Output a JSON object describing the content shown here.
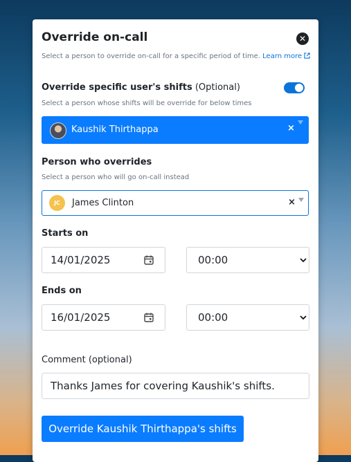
{
  "dialog": {
    "title": "Override on-call",
    "description": "Select a person to override on-call for a specific period of time.",
    "learn_more": "Learn more"
  },
  "override_user": {
    "label_bold": "Override specific user's shifts",
    "label_optional": "(Optional)",
    "toggle_on": true,
    "hint": "Select a person whose shifts will be override for below times",
    "selected_name": "Kaushik Thirthappa",
    "clear": "×"
  },
  "overrider": {
    "label": "Person who overrides",
    "hint": "Select a person who will go on-call instead",
    "initials": "JC",
    "selected_name": "James Clinton",
    "clear": "×",
    "avatar_color": "#f5c24c"
  },
  "starts": {
    "label": "Starts on",
    "date": "14/01/2025",
    "time": "00:00"
  },
  "ends": {
    "label": "Ends on",
    "date": "16/01/2025",
    "time": "00:00"
  },
  "comment": {
    "label": "Comment (optional)",
    "value": "Thanks James for covering Kaushik's shifts."
  },
  "submit_label": "Override Kaushik Thirthappa's shifts",
  "colors": {
    "accent": "#0a7cff",
    "link": "#0a74d9"
  }
}
